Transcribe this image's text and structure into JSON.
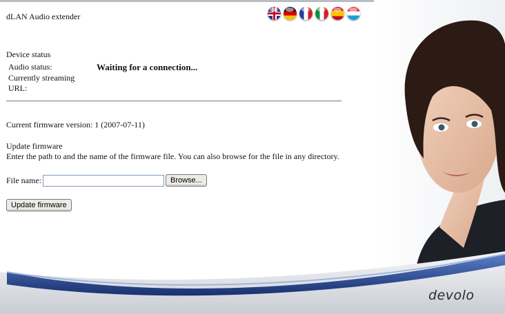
{
  "header": {
    "title": "dLAN Audio extender",
    "flags": [
      {
        "lang": "English",
        "icon": "uk-flag-icon"
      },
      {
        "lang": "Deutsch",
        "icon": "german-flag-icon"
      },
      {
        "lang": "Français",
        "icon": "french-flag-icon"
      },
      {
        "lang": "Italiano",
        "icon": "italian-flag-icon"
      },
      {
        "lang": "Español",
        "icon": "spanish-flag-icon"
      },
      {
        "lang": "Luxembourg",
        "icon": "luxembourg-flag-icon"
      }
    ]
  },
  "device_status": {
    "heading": "Device status",
    "audio_status_label": "Audio status:",
    "audio_status_value": "Waiting for a connection...",
    "streaming_url_label": "Currently streaming URL:",
    "streaming_url_value": ""
  },
  "firmware": {
    "current_version_text": "Current firmware version: 1 (2007-07-11)",
    "update_heading": "Update firmware",
    "instructions": "Enter the path to and the name of the firmware file. You can also browse for the file in any directory.",
    "file_name_label": "File name:",
    "file_name_value": "",
    "browse_label": "Browse...",
    "update_button_label": "Update firmware"
  },
  "branding": {
    "logo_text": "devolo",
    "accent_color": "#2a4fa0"
  }
}
